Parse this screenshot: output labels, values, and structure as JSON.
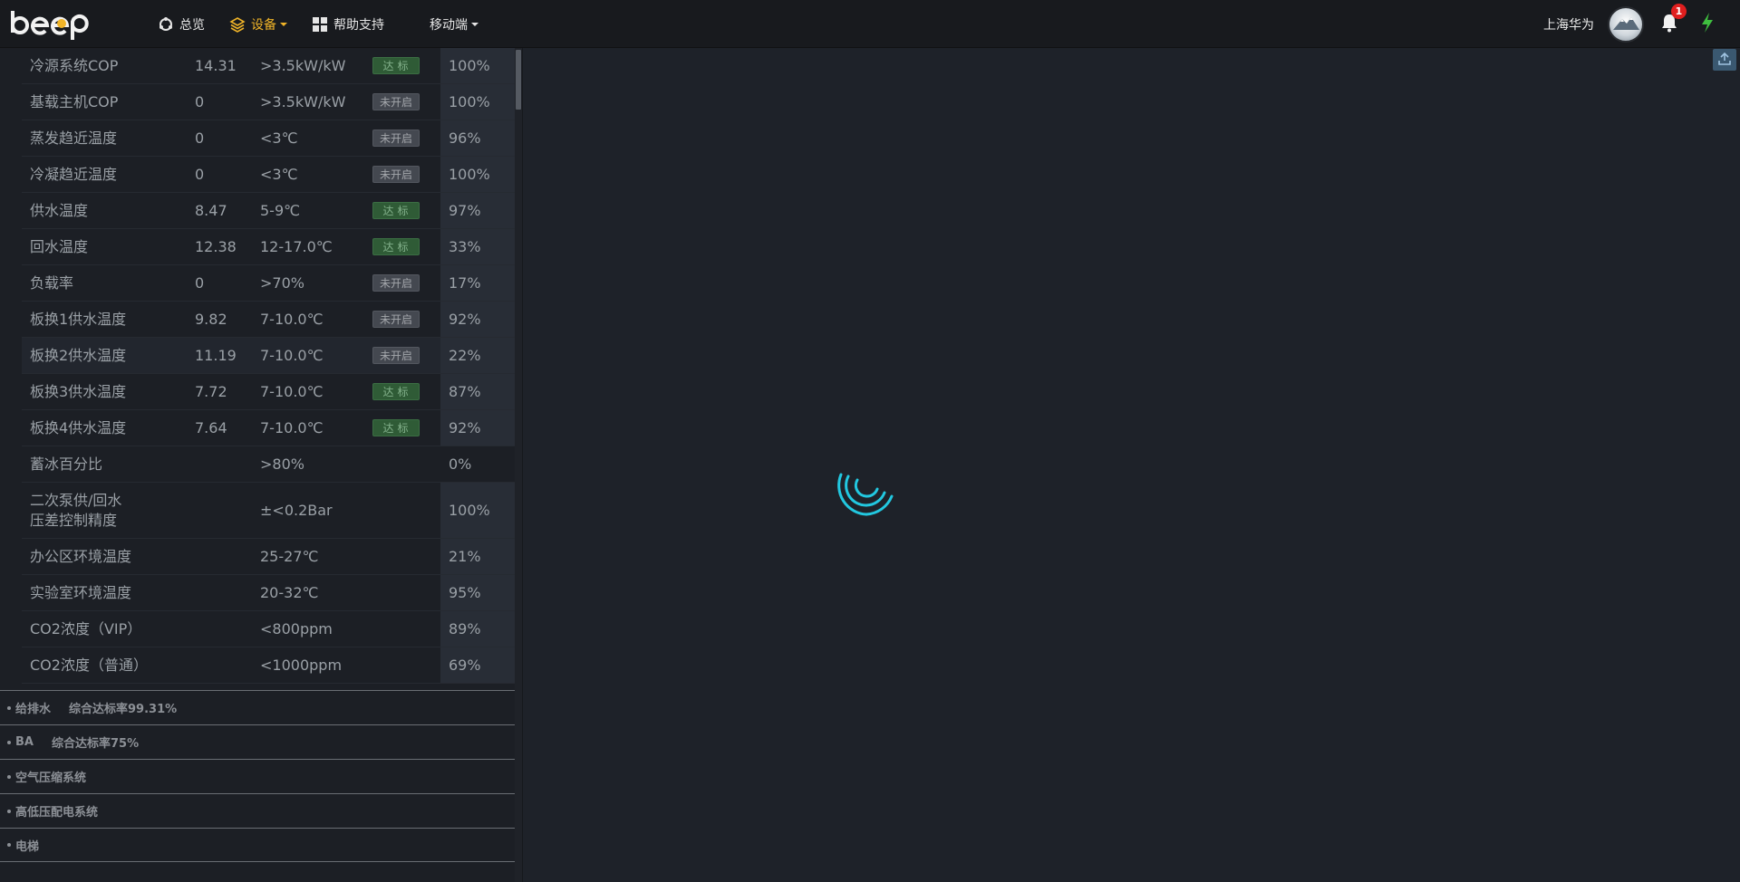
{
  "navbar": {
    "logo_text": "beep",
    "items": [
      {
        "label": "总览",
        "icon": "overview-icon"
      },
      {
        "label": "设备",
        "icon": "layers-icon",
        "active": true,
        "dropdown": true
      },
      {
        "label": "帮助支持",
        "icon": "grid-icon"
      },
      {
        "label": "移动端",
        "dropdown": true
      }
    ],
    "user_name": "上海华为",
    "notification_count": "1",
    "accent_color": "#f0b428",
    "power_icon_color": "#3fbf3f"
  },
  "kpi_table": {
    "rows": [
      {
        "name": "冷源系统COP",
        "value": "14.31",
        "standard": ">3.5kW/kW",
        "status": "达标",
        "status_type": "ok",
        "rate": "100%"
      },
      {
        "name": "基载主机COP",
        "value": "0",
        "standard": ">3.5kW/kW",
        "status": "未开启",
        "status_type": "off",
        "rate": "100%"
      },
      {
        "name": "蒸发趋近温度",
        "value": "0",
        "standard": "<3℃",
        "status": "未开启",
        "status_type": "off",
        "rate": "96%"
      },
      {
        "name": "冷凝趋近温度",
        "value": "0",
        "standard": "<3℃",
        "status": "未开启",
        "status_type": "off",
        "rate": "100%"
      },
      {
        "name": "供水温度",
        "value": "8.47",
        "standard": "5-9℃",
        "status": "达标",
        "status_type": "ok",
        "rate": "97%"
      },
      {
        "name": "回水温度",
        "value": "12.38",
        "standard": "12-17.0℃",
        "status": "达标",
        "status_type": "ok",
        "rate": "33%"
      },
      {
        "name": "负载率",
        "value": "0",
        "standard": ">70%",
        "status": "未开启",
        "status_type": "off",
        "rate": "17%"
      },
      {
        "name": "板换1供水温度",
        "value": "9.82",
        "standard": "7-10.0℃",
        "status": "未开启",
        "status_type": "off",
        "rate": "92%"
      },
      {
        "name": "板换2供水温度",
        "value": "11.19",
        "standard": "7-10.0℃",
        "status": "未开启",
        "status_type": "off",
        "rate": "22%"
      },
      {
        "name": "板换3供水温度",
        "value": "7.72",
        "standard": "7-10.0℃",
        "status": "达标",
        "status_type": "ok",
        "rate": "87%"
      },
      {
        "name": "板换4供水温度",
        "value": "7.64",
        "standard": "7-10.0℃",
        "status": "达标",
        "status_type": "ok",
        "rate": "92%"
      },
      {
        "name": "蓄冰百分比",
        "value": "",
        "standard": ">80%",
        "status": "",
        "status_type": "",
        "rate": "0%"
      },
      {
        "name": "二次泵供/回水压差控制精度",
        "value": "",
        "standard": "±<0.2Bar",
        "status": "",
        "status_type": "",
        "rate": "100%"
      },
      {
        "name": "办公区环境温度",
        "value": "",
        "standard": "25-27℃",
        "status": "",
        "status_type": "",
        "rate": "21%"
      },
      {
        "name": "实验室环境温度",
        "value": "",
        "standard": "20-32℃",
        "status": "",
        "status_type": "",
        "rate": "95%"
      },
      {
        "name": "CO2浓度（VIP）",
        "value": "",
        "standard": "<800ppm",
        "status": "",
        "status_type": "",
        "rate": "89%"
      },
      {
        "name": "CO2浓度（普通）",
        "value": "",
        "standard": "<1000ppm",
        "status": "",
        "status_type": "",
        "rate": "69%"
      }
    ]
  },
  "sections": [
    {
      "title": "给排水",
      "rate": "综合达标率99.31%"
    },
    {
      "title": "BA",
      "rate": "综合达标率75%"
    },
    {
      "title": "空气压缩系统",
      "rate": ""
    },
    {
      "title": "高低压配电系统",
      "rate": ""
    },
    {
      "title": "电梯",
      "rate": ""
    }
  ],
  "loading": {
    "color": "#22c8e0"
  }
}
